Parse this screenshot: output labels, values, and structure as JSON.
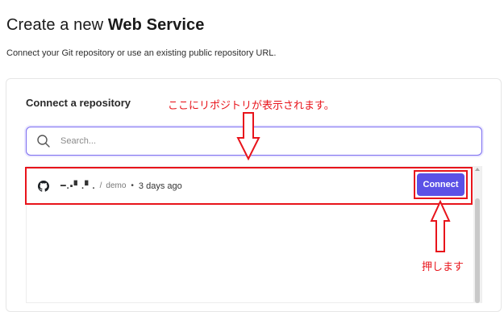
{
  "header": {
    "title_prefix": "Create a new ",
    "title_bold": "Web Service",
    "subtitle": "Connect your Git repository or use an existing public repository URL."
  },
  "repo_panel": {
    "heading": "Connect a repository",
    "search_placeholder": "Search...",
    "repositories": [
      {
        "owner": "━.▪▘.▘.",
        "separator": "/",
        "name": "demo",
        "dot": "•",
        "updated": "3 days ago",
        "connect_label": "Connect"
      }
    ]
  },
  "annotations": {
    "list_note": "ここにリポジトリが表示されます。",
    "button_note": "押します",
    "color": "#e8141b"
  },
  "icons": {
    "search": "search-icon",
    "repo_provider": "github-icon"
  },
  "colors": {
    "accent": "#5b51e6",
    "annotation": "#e8141b"
  }
}
